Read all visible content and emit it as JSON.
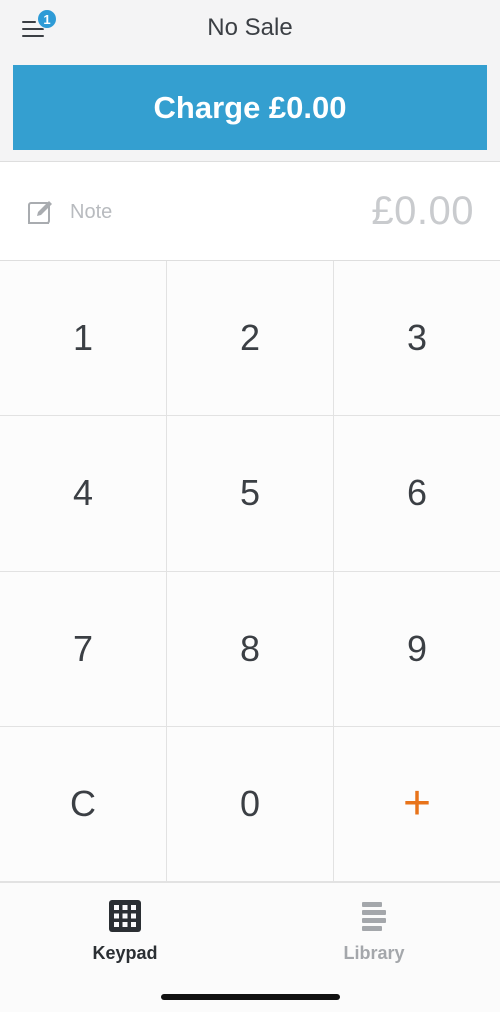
{
  "header": {
    "title": "No Sale",
    "menu_badge": "1",
    "charge_label": "Charge £0.00"
  },
  "note_row": {
    "note_label": "Note",
    "amount": "£0.00"
  },
  "keypad": {
    "keys": [
      "1",
      "2",
      "3",
      "4",
      "5",
      "6",
      "7",
      "8",
      "9",
      "C",
      "0",
      "+"
    ]
  },
  "tabs": {
    "keypad_label": "Keypad",
    "library_label": "Library"
  },
  "colors": {
    "accent_blue": "#349fd0",
    "plus_orange": "#e8731a",
    "active_tab": "#2b2f33",
    "inactive_tab": "#a4a7ab"
  },
  "icons": {
    "menu": "hamburger-menu-icon",
    "note": "edit-note-icon",
    "keypad_tab": "keypad-grid-icon",
    "library_tab": "library-list-icon"
  }
}
